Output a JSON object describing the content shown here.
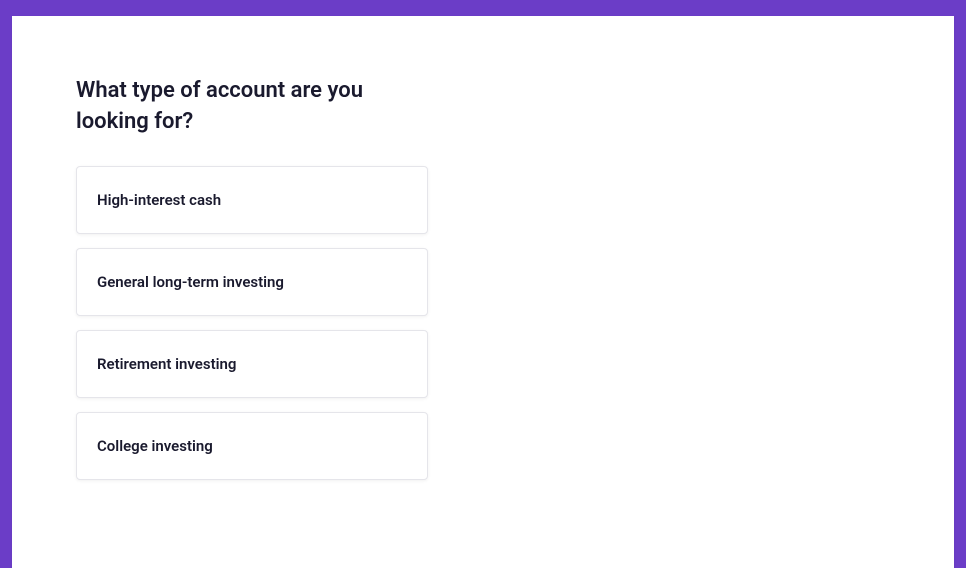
{
  "question": {
    "title": "What type of account are you looking for?"
  },
  "options": [
    {
      "label": "High-interest cash"
    },
    {
      "label": "General long-term investing"
    },
    {
      "label": "Retirement investing"
    },
    {
      "label": "College investing"
    }
  ],
  "colors": {
    "accent": "#6b3dc7"
  }
}
